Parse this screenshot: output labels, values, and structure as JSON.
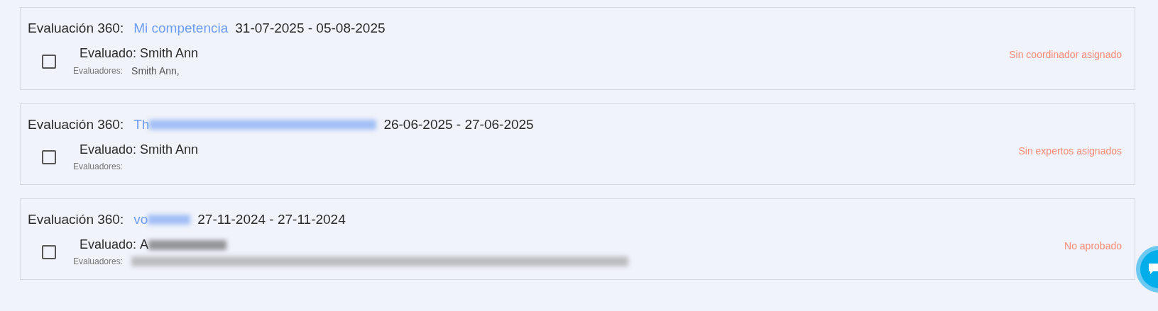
{
  "evaluations": [
    {
      "type_label": "Evaluación 360:",
      "competence": "Mi competencia",
      "competence_redacted": false,
      "period": "31-07-2025 - 05-08-2025",
      "checked": false,
      "evaluated_label": "Evaluado:",
      "evaluated": "Smith Ann",
      "evaluated_redacted": false,
      "evaluators_label": "Evaluadores:",
      "evaluators": "Smith Ann,",
      "evaluators_redacted": false,
      "status": "Sin coordinador asignado"
    },
    {
      "type_label": "Evaluación 360:",
      "competence": "Th",
      "competence_redacted": true,
      "period": "26-06-2025 - 27-06-2025",
      "checked": false,
      "evaluated_label": "Evaluado:",
      "evaluated": "Smith Ann",
      "evaluated_redacted": false,
      "evaluators_label": "Evaluadores:",
      "evaluators_redacted": false,
      "status": "Sin expertos asignados"
    },
    {
      "type_label": "Evaluación 360:",
      "competence": "vo",
      "competence_redacted": true,
      "period": "27-11-2024 - 27-11-2024",
      "checked": false,
      "evaluated_label": "Evaluado:",
      "evaluated": "A",
      "evaluated_redacted": true,
      "evaluators_label": "Evaluadores:",
      "evaluators_redacted": true,
      "status": "No aprobado"
    }
  ]
}
